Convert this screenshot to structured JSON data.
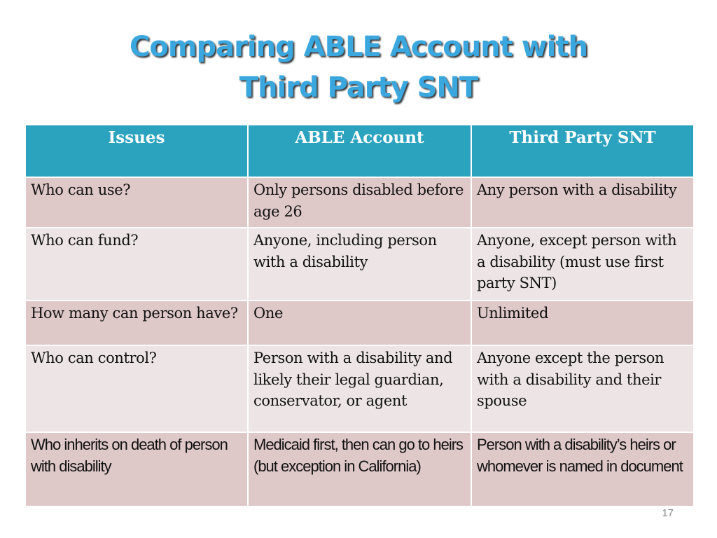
{
  "slide": {
    "title_line1": "Comparing ABLE Account with",
    "title_line2": "Third Party SNT",
    "page_number": "17"
  },
  "table": {
    "headers": [
      "Issues",
      "ABLE Account",
      "Third Party SNT"
    ],
    "rows": [
      [
        "Who can use?",
        "Only persons disabled before age 26",
        "Any person with a disability"
      ],
      [
        "Who can fund?",
        "Anyone, including person with a disability",
        "Anyone, except person with a disability (must use first party SNT)"
      ],
      [
        "How many can person have?",
        "One",
        "Unlimited"
      ],
      [
        "Who can control?",
        "Person with a disability and likely their legal guardian, conservator, or agent",
        "Anyone except the person with a disability and their spouse"
      ],
      [
        "Who inherits on death of person with disability",
        "Medicaid first, then can go to heirs (but exception in California)",
        "Person with a disability’s heirs or whomever is named in document"
      ]
    ]
  },
  "colors": {
    "title": "#3aa7df",
    "header_bg": "#2ba3bf",
    "row_dark": "#dfc8c8",
    "row_light": "#ede5e5"
  }
}
